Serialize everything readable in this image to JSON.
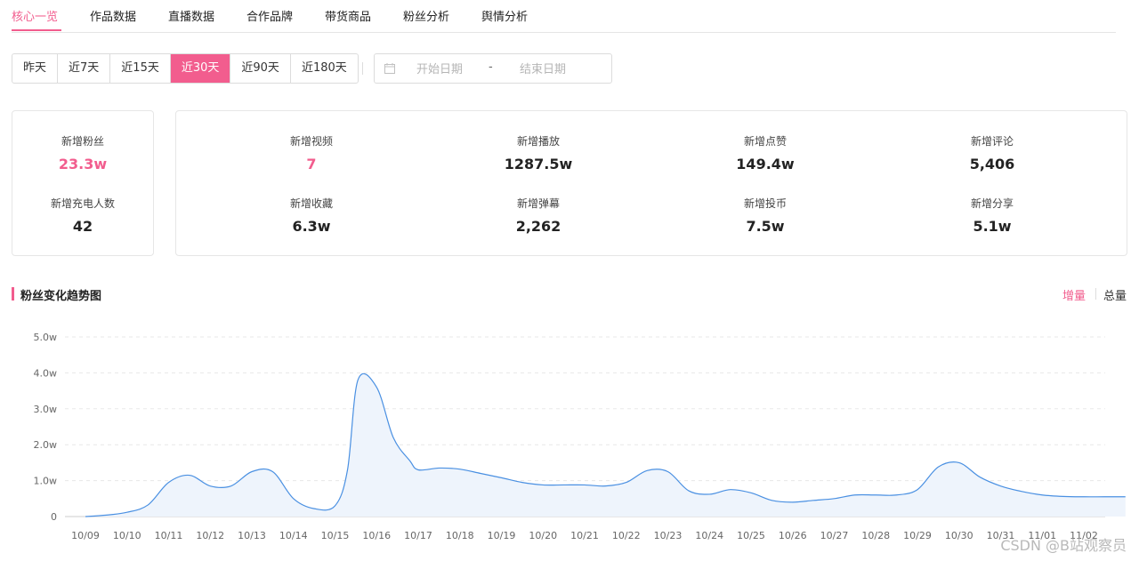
{
  "tabs": [
    "核心一览",
    "作品数据",
    "直播数据",
    "合作品牌",
    "带货商品",
    "粉丝分析",
    "舆情分析"
  ],
  "ranges": [
    "昨天",
    "近7天",
    "近15天",
    "近30天",
    "近90天",
    "近180天"
  ],
  "date_picker": {
    "start_placeholder": "开始日期",
    "separator": "-",
    "end_placeholder": "结束日期"
  },
  "left_stats": [
    {
      "label": "新增粉丝",
      "value": "23.3w"
    },
    {
      "label": "新增充电人数",
      "value": "42"
    }
  ],
  "right_stats": [
    {
      "label": "新增视频",
      "value": "7"
    },
    {
      "label": "新增播放",
      "value": "1287.5w"
    },
    {
      "label": "新增点赞",
      "value": "149.4w"
    },
    {
      "label": "新增评论",
      "value": "5,406"
    },
    {
      "label": "新增收藏",
      "value": "6.3w"
    },
    {
      "label": "新增弹幕",
      "value": "2,262"
    },
    {
      "label": "新增投币",
      "value": "7.5w"
    },
    {
      "label": "新增分享",
      "value": "5.1w"
    }
  ],
  "section": {
    "title": "粉丝变化趋势图",
    "toggle_increment": "增量",
    "toggle_total": "总量"
  },
  "chart_data": {
    "type": "area",
    "y_tick_labels": [
      "0",
      "1.0w",
      "2.0w",
      "3.0w",
      "4.0w",
      "5.0w"
    ],
    "ylim": [
      0,
      5.0
    ],
    "categories": [
      "10/09",
      "10/10",
      "10/11",
      "10/12",
      "10/13",
      "10/14",
      "10/15",
      "10/16",
      "10/17",
      "10/18",
      "10/19",
      "10/20",
      "10/21",
      "10/22",
      "10/23",
      "10/24",
      "10/25",
      "10/26",
      "10/27",
      "10/28",
      "10/29",
      "10/30",
      "10/31",
      "11/01",
      "11/02"
    ],
    "x": [
      0.0,
      0.5,
      1.0,
      1.5,
      2.0,
      2.5,
      3.0,
      3.5,
      4.0,
      4.5,
      5.0,
      5.5,
      6.0,
      6.3,
      6.55,
      7.0,
      7.4,
      7.8,
      8.0,
      8.5,
      9.0,
      9.5,
      10.0,
      10.5,
      11.0,
      11.5,
      12.0,
      12.5,
      13.0,
      13.5,
      14.0,
      14.5,
      15.0,
      15.5,
      16.0,
      16.5,
      17.0,
      17.5,
      18.0,
      18.5,
      19.0,
      19.5,
      20.0,
      20.5,
      21.0,
      21.5,
      22.0,
      22.5,
      23.0,
      23.5,
      24.0,
      24.5,
      25.0
    ],
    "values": [
      0.0,
      0.04,
      0.12,
      0.32,
      0.95,
      1.15,
      0.85,
      0.85,
      1.25,
      1.25,
      0.5,
      0.22,
      0.3,
      1.3,
      3.8,
      3.6,
      2.2,
      1.55,
      1.3,
      1.35,
      1.32,
      1.2,
      1.08,
      0.95,
      0.88,
      0.88,
      0.88,
      0.85,
      0.95,
      1.28,
      1.25,
      0.72,
      0.62,
      0.75,
      0.66,
      0.45,
      0.4,
      0.45,
      0.5,
      0.6,
      0.6,
      0.6,
      0.75,
      1.38,
      1.5,
      1.1,
      0.85,
      0.7,
      0.6,
      0.56,
      0.55,
      0.55,
      0.55
    ],
    "line_color": "#4a90e2",
    "fill_color": "#eef4fc",
    "grid": true
  },
  "watermark": "CSDN @B站观察员"
}
